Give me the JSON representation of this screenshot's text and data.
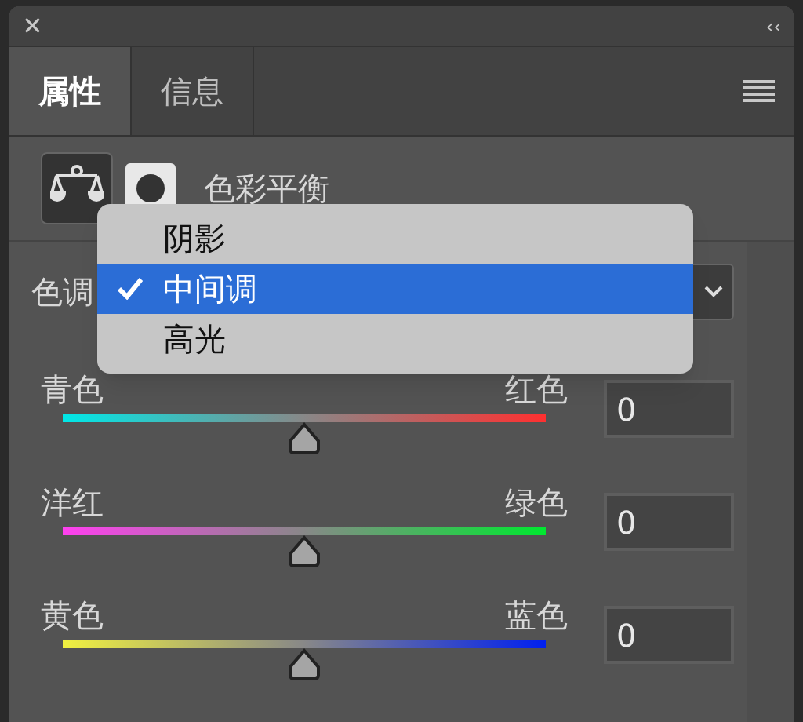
{
  "window": {
    "close": "✕",
    "collapse": "‹‹"
  },
  "tabs": [
    {
      "label": "属性",
      "selected": true
    },
    {
      "label": "信息",
      "selected": false
    }
  ],
  "header": {
    "title": "色彩平衡"
  },
  "tone": {
    "label": "色调"
  },
  "tone_menu": [
    {
      "label": "阴影",
      "selected": false
    },
    {
      "label": "中间调",
      "selected": true
    },
    {
      "label": "高光",
      "selected": false
    }
  ],
  "sliders": [
    {
      "left": "青色",
      "right": "红色",
      "level": 0.5,
      "value": "0"
    },
    {
      "left": "洋红",
      "right": "绿色",
      "level": 0.5,
      "value": "0"
    },
    {
      "left": "黄色",
      "right": "蓝色",
      "level": 0.5,
      "value": "0"
    }
  ]
}
